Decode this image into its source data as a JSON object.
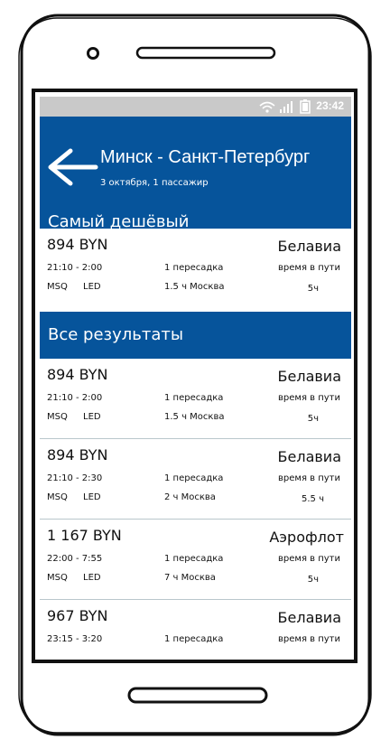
{
  "status_bar": {
    "time": "23:42",
    "icons": [
      "wifi-icon",
      "signal-icon",
      "battery-icon"
    ]
  },
  "header": {
    "route": "Минск - Санкт-Петербург",
    "subtitle": "3 октября, 1 пассажир",
    "back_icon": "arrow-left-icon"
  },
  "cheapest": {
    "title": "Самый дешёвый",
    "flight": {
      "price": "894 BYN",
      "airline": "Белавиа",
      "times": "21:10 - 2:00",
      "stops": "1 пересадка",
      "travel_label": "время в пути",
      "codes": "MSQ LED",
      "layover": "1.5 ч Москва",
      "duration": "5ч"
    }
  },
  "all_results": {
    "title": "Все результаты",
    "flights": [
      {
        "price": "894 BYN",
        "airline": "Белавиа",
        "times": "21:10 - 2:00",
        "stops": "1 пересадка",
        "travel_label": "время в пути",
        "codes": "MSQ LED",
        "layover": "1.5 ч Москва",
        "duration": "5ч"
      },
      {
        "price": "894 BYN",
        "airline": "Белавиа",
        "times": "21:10 - 2:30",
        "stops": "1 пересадка",
        "travel_label": "время в пути",
        "codes": "MSQ LED",
        "layover": "2 ч Москва",
        "duration": "5.5 ч"
      },
      {
        "price": "1 167 BYN",
        "airline": "Аэрофлот",
        "times": "22:00 - 7:55",
        "stops": "1 пересадка",
        "travel_label": "время в пути",
        "codes": "MSQ LED",
        "layover": "7 ч Москва",
        "duration": "5ч"
      },
      {
        "price": "967 BYN",
        "airline": "Белавиа",
        "times": "23:15 - 3:20",
        "stops": "1 пересадка",
        "travel_label": "время в пути",
        "codes": "",
        "layover": "",
        "duration": ""
      }
    ]
  }
}
